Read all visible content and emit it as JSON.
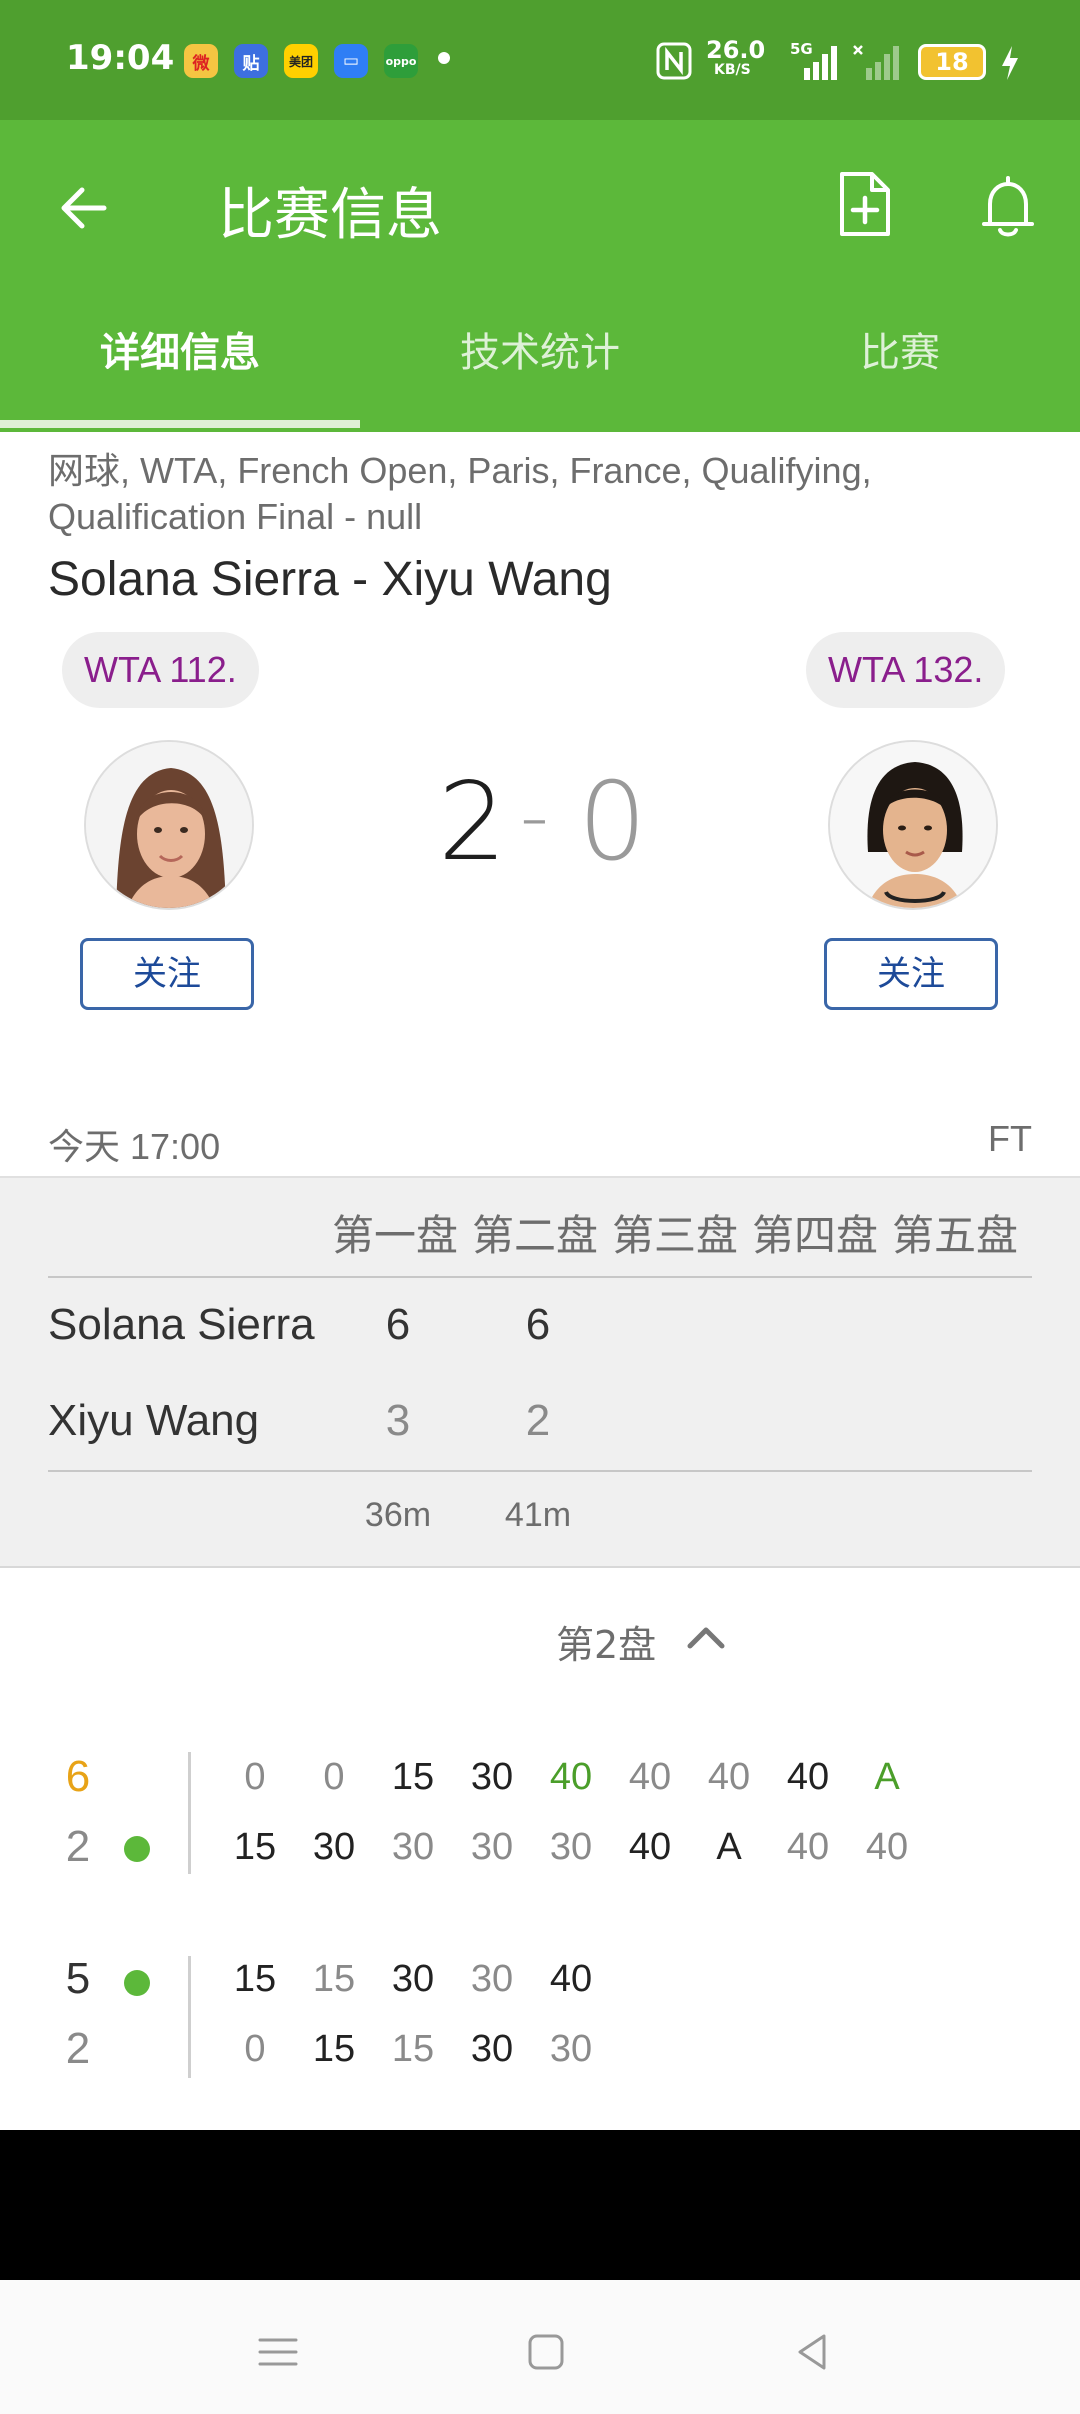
{
  "status_bar": {
    "time": "19:04",
    "net_speed": "26.0",
    "net_unit": "KB/S",
    "signal_label": "5G",
    "battery": "18",
    "app_icons": [
      "weibo-icon",
      "tieba-icon",
      "meituan-icon",
      "messages-icon",
      "oppo-icon"
    ],
    "app_icon_labels": [
      "微",
      "贴",
      "美团",
      "▭",
      "oppo"
    ]
  },
  "header": {
    "title": "比赛信息",
    "tabs": [
      "详细信息",
      "技术统计",
      "比赛"
    ],
    "active_tab": 0
  },
  "match": {
    "competition": "网球, WTA, French Open, Paris, France, Qualifying, Qualification Final - null",
    "title": "Solana Sierra - Xiyu Wang",
    "home": {
      "rank": "WTA 112.",
      "follow_label": "关注"
    },
    "away": {
      "rank": "WTA 132.",
      "follow_label": "关注"
    },
    "score_home": "2",
    "score_sep": "-",
    "score_away": "0",
    "date": "今天 17:00",
    "status": "FT"
  },
  "sets": {
    "headers": [
      "第一盘",
      "第二盘",
      "第三盘",
      "第四盘",
      "第五盘"
    ],
    "players": [
      {
        "name": "Solana Sierra",
        "scores": [
          "6",
          "6"
        ]
      },
      {
        "name": "Xiyu Wang",
        "scores": [
          "3",
          "2"
        ]
      }
    ],
    "durations": [
      "36m",
      "41m"
    ]
  },
  "set_selector": {
    "label": "第2盘"
  },
  "games": [
    {
      "top_score": "6",
      "bottom_score": "2",
      "server": "bottom",
      "top_points": [
        "0",
        "0",
        "15",
        "30",
        "40",
        "40",
        "40",
        "40",
        "A"
      ],
      "bottom_points": [
        "15",
        "30",
        "30",
        "30",
        "30",
        "40",
        "A",
        "40",
        "40"
      ]
    },
    {
      "top_score": "5",
      "bottom_score": "2",
      "server": "top",
      "top_points": [
        "15",
        "15",
        "30",
        "30",
        "40"
      ],
      "bottom_points": [
        "0",
        "15",
        "15",
        "30",
        "30"
      ]
    }
  ],
  "colors": {
    "status_bar": "#4f9f2f",
    "app_bar": "#5cb83a",
    "rank_text": "#8a1e8c",
    "follow_border": "#3a66a8",
    "game_point_green": "#4b9e2a",
    "winner_orange": "#e8a317"
  }
}
